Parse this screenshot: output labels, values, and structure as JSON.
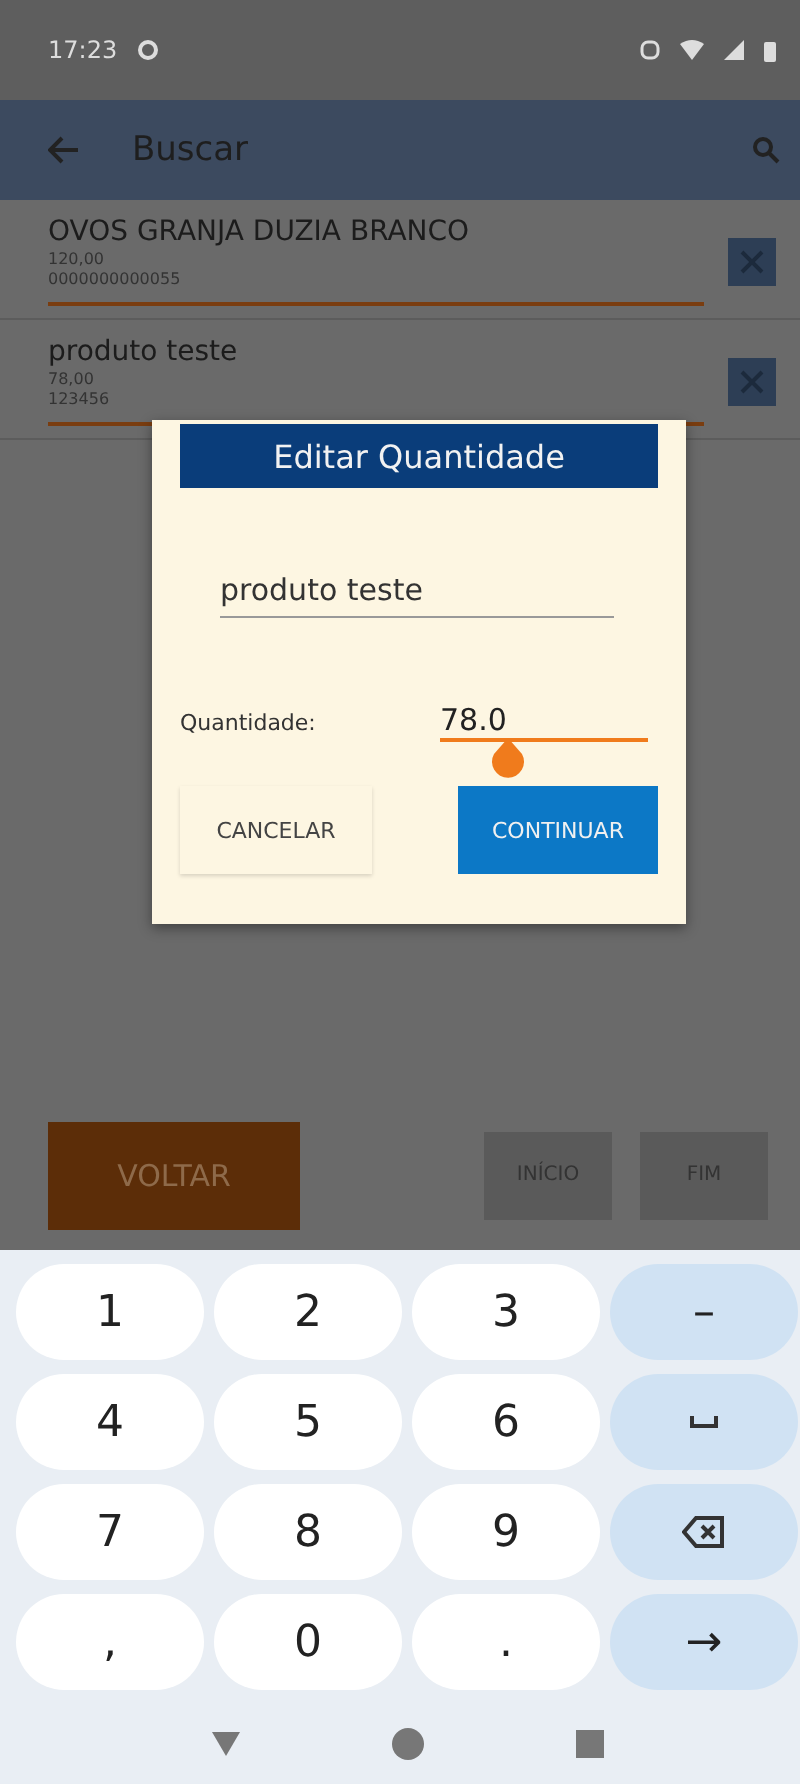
{
  "status_bar": {
    "time": "17:23"
  },
  "app_bar": {
    "title": "Buscar"
  },
  "items": [
    {
      "name": "OVOS GRANJA DUZIA BRANCO",
      "quantity": "120,00",
      "code": "0000000000055"
    },
    {
      "name": "produto teste",
      "quantity": "78,00",
      "code": "123456"
    }
  ],
  "dialog": {
    "title": "Editar Quantidade",
    "product_field": {
      "value": "produto teste"
    },
    "quantity_label": "Quantidade:",
    "quantity_field": {
      "value": "78.0"
    },
    "buttons": [
      {
        "label": "CANCELAR",
        "kind": "flat"
      },
      {
        "label": "CONTINUAR",
        "kind": "primary"
      }
    ]
  },
  "bottom_buttons": [
    {
      "label": "VOLTAR",
      "kind": "primary"
    },
    {
      "label": "INÍCIO",
      "kind": "nav"
    },
    {
      "label": "FIM",
      "kind": "nav"
    }
  ],
  "keyboard": {
    "rows": [
      [
        {
          "label": "1",
          "kind": "key"
        },
        {
          "label": "2",
          "kind": "key"
        },
        {
          "label": "3",
          "kind": "key"
        },
        {
          "label": "–",
          "kind": "func"
        }
      ],
      [
        {
          "label": "4",
          "kind": "key"
        },
        {
          "label": "5",
          "kind": "key"
        },
        {
          "label": "6",
          "kind": "key"
        },
        {
          "kind": "space"
        }
      ],
      [
        {
          "label": "7",
          "kind": "key"
        },
        {
          "label": "8",
          "kind": "key"
        },
        {
          "label": "9",
          "kind": "key"
        },
        {
          "kind": "backspace"
        }
      ],
      [
        {
          "label": ",",
          "kind": "key"
        },
        {
          "label": "0",
          "kind": "key"
        },
        {
          "label": ".",
          "kind": "key"
        },
        {
          "label": "→",
          "kind": "func"
        }
      ]
    ]
  }
}
